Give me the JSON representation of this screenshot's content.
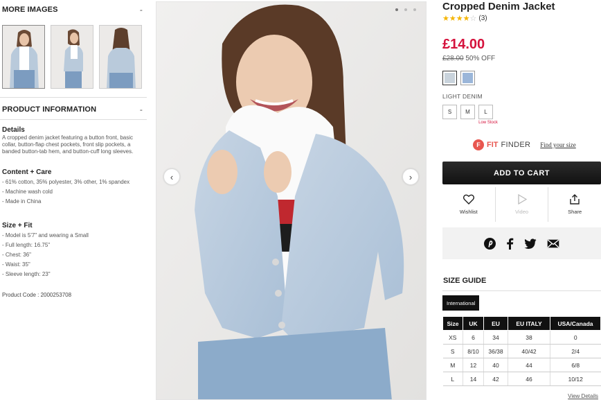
{
  "left": {
    "more_images": {
      "title": "MORE IMAGES",
      "toggle": "-"
    },
    "thumbnails": [
      {
        "alt": "front view",
        "icon": "thumbnail-front"
      },
      {
        "alt": "side view",
        "icon": "thumbnail-side"
      },
      {
        "alt": "back view",
        "icon": "thumbnail-back"
      }
    ],
    "product_info": {
      "title": "PRODUCT INFORMATION",
      "toggle": "-"
    },
    "details": {
      "heading": "Details",
      "text": "A cropped denim jacket featuring a button front, basic collar, button-flap chest pockets, front slip pockets, a banded button-tab hem, and button-cuff long sleeves."
    },
    "content_care": {
      "heading": "Content + Care",
      "items": [
        "- 61% cotton, 35% polyester, 3% other, 1% spandex",
        "- Machine wash cold",
        "- Made in China"
      ]
    },
    "size_fit": {
      "heading": "Size + Fit",
      "items": [
        "- Model is 5'7\" and wearing a Small",
        "- Full length: 16.75\"",
        "- Chest: 36\"",
        "- Waist: 35\"",
        "- Sleeve length: 23\""
      ]
    },
    "product_code": "Product Code : 2000253708"
  },
  "main_image": {
    "prev_icon": "chevron-left",
    "next_icon": "chevron-right",
    "prev_glyph": "‹",
    "next_glyph": "›",
    "dots_active_index": 0
  },
  "product": {
    "title": "Cropped Denim Jacket",
    "rating": 4,
    "rating_max": 5,
    "review_count": "(3)",
    "price": "£14.00",
    "old_price": "£28.00",
    "discount": "50% OFF",
    "swatches": [
      {
        "color": "#c9d3dc",
        "selected": true
      },
      {
        "color": "#9bb6d9",
        "selected": false
      }
    ],
    "color_label": "LIGHT DENIM",
    "sizes": [
      "S",
      "M",
      "L"
    ],
    "low_stock_note": "Low Stock",
    "fit_finder": {
      "fit": "FIT",
      "finder": "FINDER",
      "link": "Find your size",
      "icon": "fitfinder-logo",
      "glyph": "F"
    },
    "add_to_cart": "ADD TO CART",
    "actions": [
      {
        "label": "Wishlist",
        "icon": "heart-icon"
      },
      {
        "label": "Video",
        "icon": "play-icon"
      },
      {
        "label": "Share",
        "icon": "share-icon"
      }
    ],
    "share_icons": [
      "pinterest-icon",
      "facebook-icon",
      "twitter-icon",
      "email-icon"
    ]
  },
  "size_guide": {
    "title": "SIZE GUIDE",
    "tab": "International",
    "headers": [
      "Size",
      "UK",
      "EU",
      "EU ITALY",
      "USA/Canada"
    ],
    "rows": [
      [
        "XS",
        "6",
        "34",
        "38",
        "0"
      ],
      [
        "S",
        "8/10",
        "36/38",
        "40/42",
        "2/4"
      ],
      [
        "M",
        "12",
        "40",
        "44",
        "6/8"
      ],
      [
        "L",
        "14",
        "42",
        "46",
        "10/12"
      ]
    ],
    "view_details": "View Details"
  },
  "colors": {
    "accent_red": "#d5123c",
    "fit_finder": "#e8564f",
    "star": "#f4b400"
  }
}
